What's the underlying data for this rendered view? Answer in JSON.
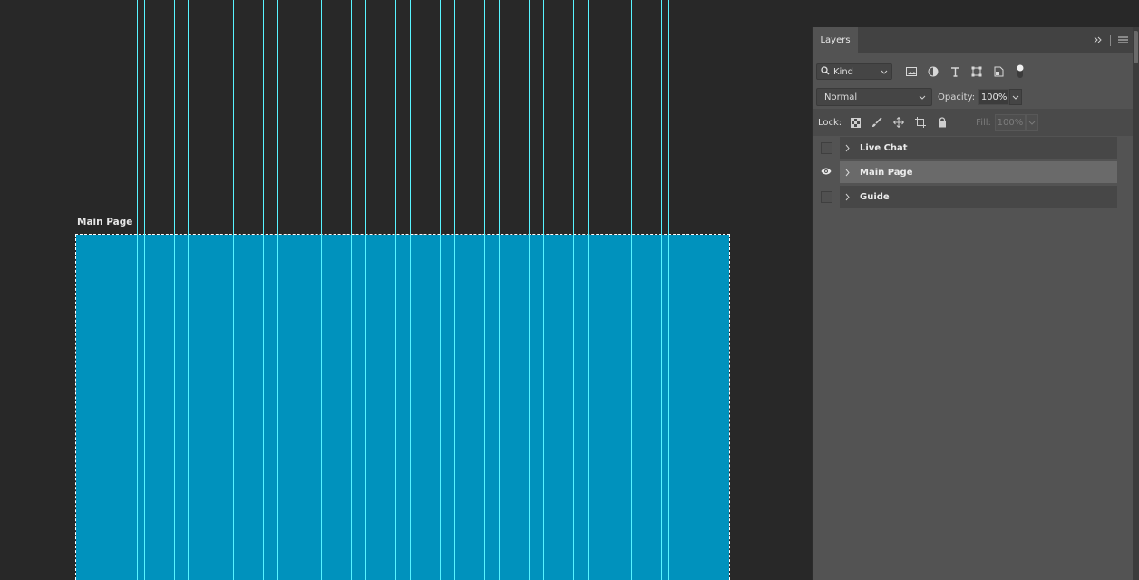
{
  "artboard": {
    "label": "Main Page",
    "fill": "#0092bd"
  },
  "guides": {
    "color": "#58f4ff"
  },
  "panel": {
    "tab_label": "Layers",
    "filter": {
      "kind_label": "Kind",
      "icons": [
        "image-filter-icon",
        "adjustment-filter-icon",
        "type-filter-icon",
        "shape-filter-icon",
        "smart-object-filter-icon",
        "filter-toggle-icon"
      ]
    },
    "blend_mode": "Normal",
    "opacity_label": "Opacity:",
    "opacity_value": "100%",
    "lock_label": "Lock:",
    "fill_label": "Fill:",
    "fill_value": "100%",
    "layers": [
      {
        "name": "Live Chat",
        "visible": false,
        "selected": false
      },
      {
        "name": "Main Page",
        "visible": true,
        "selected": true
      },
      {
        "name": "Guide",
        "visible": false,
        "selected": false
      }
    ]
  }
}
